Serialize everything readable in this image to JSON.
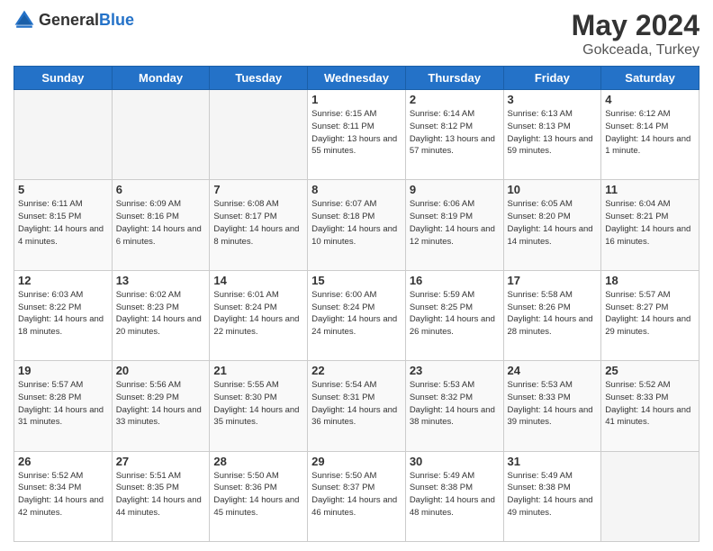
{
  "header": {
    "logo_general": "General",
    "logo_blue": "Blue",
    "main_title": "May 2024",
    "subtitle": "Gokceada, Turkey"
  },
  "calendar": {
    "headers": [
      "Sunday",
      "Monday",
      "Tuesday",
      "Wednesday",
      "Thursday",
      "Friday",
      "Saturday"
    ],
    "weeks": [
      [
        {
          "day": "",
          "info": ""
        },
        {
          "day": "",
          "info": ""
        },
        {
          "day": "",
          "info": ""
        },
        {
          "day": "1",
          "info": "Sunrise: 6:15 AM\nSunset: 8:11 PM\nDaylight: 13 hours\nand 55 minutes."
        },
        {
          "day": "2",
          "info": "Sunrise: 6:14 AM\nSunset: 8:12 PM\nDaylight: 13 hours\nand 57 minutes."
        },
        {
          "day": "3",
          "info": "Sunrise: 6:13 AM\nSunset: 8:13 PM\nDaylight: 13 hours\nand 59 minutes."
        },
        {
          "day": "4",
          "info": "Sunrise: 6:12 AM\nSunset: 8:14 PM\nDaylight: 14 hours\nand 1 minute."
        }
      ],
      [
        {
          "day": "5",
          "info": "Sunrise: 6:11 AM\nSunset: 8:15 PM\nDaylight: 14 hours\nand 4 minutes."
        },
        {
          "day": "6",
          "info": "Sunrise: 6:09 AM\nSunset: 8:16 PM\nDaylight: 14 hours\nand 6 minutes."
        },
        {
          "day": "7",
          "info": "Sunrise: 6:08 AM\nSunset: 8:17 PM\nDaylight: 14 hours\nand 8 minutes."
        },
        {
          "day": "8",
          "info": "Sunrise: 6:07 AM\nSunset: 8:18 PM\nDaylight: 14 hours\nand 10 minutes."
        },
        {
          "day": "9",
          "info": "Sunrise: 6:06 AM\nSunset: 8:19 PM\nDaylight: 14 hours\nand 12 minutes."
        },
        {
          "day": "10",
          "info": "Sunrise: 6:05 AM\nSunset: 8:20 PM\nDaylight: 14 hours\nand 14 minutes."
        },
        {
          "day": "11",
          "info": "Sunrise: 6:04 AM\nSunset: 8:21 PM\nDaylight: 14 hours\nand 16 minutes."
        }
      ],
      [
        {
          "day": "12",
          "info": "Sunrise: 6:03 AM\nSunset: 8:22 PM\nDaylight: 14 hours\nand 18 minutes."
        },
        {
          "day": "13",
          "info": "Sunrise: 6:02 AM\nSunset: 8:23 PM\nDaylight: 14 hours\nand 20 minutes."
        },
        {
          "day": "14",
          "info": "Sunrise: 6:01 AM\nSunset: 8:24 PM\nDaylight: 14 hours\nand 22 minutes."
        },
        {
          "day": "15",
          "info": "Sunrise: 6:00 AM\nSunset: 8:24 PM\nDaylight: 14 hours\nand 24 minutes."
        },
        {
          "day": "16",
          "info": "Sunrise: 5:59 AM\nSunset: 8:25 PM\nDaylight: 14 hours\nand 26 minutes."
        },
        {
          "day": "17",
          "info": "Sunrise: 5:58 AM\nSunset: 8:26 PM\nDaylight: 14 hours\nand 28 minutes."
        },
        {
          "day": "18",
          "info": "Sunrise: 5:57 AM\nSunset: 8:27 PM\nDaylight: 14 hours\nand 29 minutes."
        }
      ],
      [
        {
          "day": "19",
          "info": "Sunrise: 5:57 AM\nSunset: 8:28 PM\nDaylight: 14 hours\nand 31 minutes."
        },
        {
          "day": "20",
          "info": "Sunrise: 5:56 AM\nSunset: 8:29 PM\nDaylight: 14 hours\nand 33 minutes."
        },
        {
          "day": "21",
          "info": "Sunrise: 5:55 AM\nSunset: 8:30 PM\nDaylight: 14 hours\nand 35 minutes."
        },
        {
          "day": "22",
          "info": "Sunrise: 5:54 AM\nSunset: 8:31 PM\nDaylight: 14 hours\nand 36 minutes."
        },
        {
          "day": "23",
          "info": "Sunrise: 5:53 AM\nSunset: 8:32 PM\nDaylight: 14 hours\nand 38 minutes."
        },
        {
          "day": "24",
          "info": "Sunrise: 5:53 AM\nSunset: 8:33 PM\nDaylight: 14 hours\nand 39 minutes."
        },
        {
          "day": "25",
          "info": "Sunrise: 5:52 AM\nSunset: 8:33 PM\nDaylight: 14 hours\nand 41 minutes."
        }
      ],
      [
        {
          "day": "26",
          "info": "Sunrise: 5:52 AM\nSunset: 8:34 PM\nDaylight: 14 hours\nand 42 minutes."
        },
        {
          "day": "27",
          "info": "Sunrise: 5:51 AM\nSunset: 8:35 PM\nDaylight: 14 hours\nand 44 minutes."
        },
        {
          "day": "28",
          "info": "Sunrise: 5:50 AM\nSunset: 8:36 PM\nDaylight: 14 hours\nand 45 minutes."
        },
        {
          "day": "29",
          "info": "Sunrise: 5:50 AM\nSunset: 8:37 PM\nDaylight: 14 hours\nand 46 minutes."
        },
        {
          "day": "30",
          "info": "Sunrise: 5:49 AM\nSunset: 8:38 PM\nDaylight: 14 hours\nand 48 minutes."
        },
        {
          "day": "31",
          "info": "Sunrise: 5:49 AM\nSunset: 8:38 PM\nDaylight: 14 hours\nand 49 minutes."
        },
        {
          "day": "",
          "info": ""
        }
      ]
    ]
  }
}
